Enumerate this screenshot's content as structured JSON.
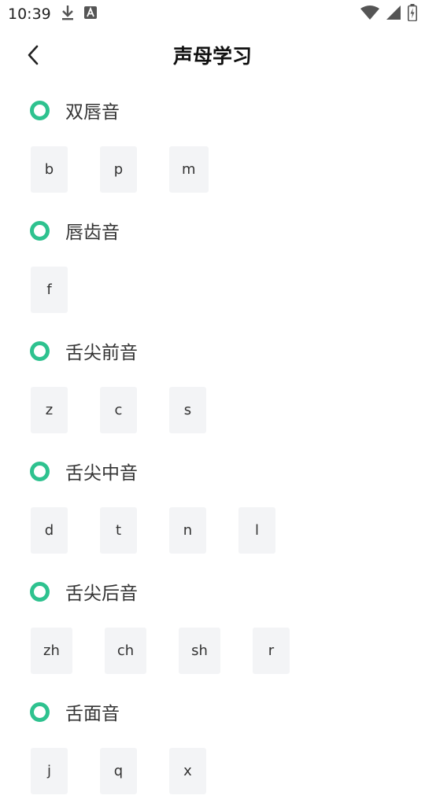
{
  "status_bar": {
    "time": "10:39",
    "icons": [
      "download-icon",
      "a-badge-icon",
      "wifi-icon",
      "signal-icon",
      "battery-charging-icon"
    ]
  },
  "header": {
    "title": "声母学习",
    "back_icon": "chevron-left-icon"
  },
  "sections": [
    {
      "title": "双唇音",
      "keys": [
        "b",
        "p",
        "m"
      ]
    },
    {
      "title": "唇齿音",
      "keys": [
        "f"
      ]
    },
    {
      "title": "舌尖前音",
      "keys": [
        "z",
        "c",
        "s"
      ]
    },
    {
      "title": "舌尖中音",
      "keys": [
        "d",
        "t",
        "n",
        "l"
      ]
    },
    {
      "title": "舌尖后音",
      "keys": [
        "zh",
        "ch",
        "sh",
        "r"
      ]
    },
    {
      "title": "舌面音",
      "keys": [
        "j",
        "q",
        "x"
      ]
    }
  ],
  "colors": {
    "accent": "#2ec28f",
    "key_bg": "#f3f4f6",
    "text": "#333333"
  }
}
